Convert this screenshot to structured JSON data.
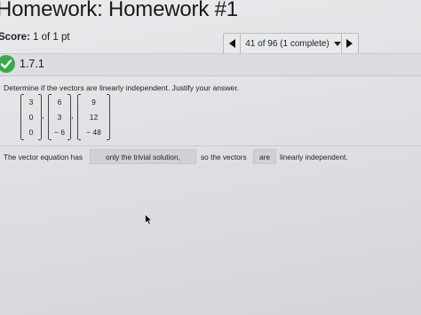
{
  "header": {
    "title": "Homework: Homework #1",
    "score_label": "Score:",
    "score_value": "1 of 1 pt"
  },
  "navigator": {
    "status": "41 of 96 (1 complete)",
    "prev_icon": "triangle-left-icon",
    "next_icon": "triangle-right-icon",
    "dropdown_icon": "triangle-down-icon"
  },
  "question": {
    "number": "1.7.1",
    "status_icon": "check-icon",
    "status_color": "#3aaa49",
    "prompt": "Determine if the vectors are linearly independent. Justify your answer.",
    "vectors": [
      [
        "3",
        "0",
        "0"
      ],
      [
        "6",
        "3",
        "− 6"
      ],
      [
        "9",
        "12",
        "− 48"
      ]
    ],
    "separator": ",",
    "sentence_start": "The vector equation has",
    "answer_1": "only the trivial solution,",
    "sentence_mid": "so the vectors",
    "answer_2": "are",
    "sentence_end": "linearly independent."
  },
  "pointer": "mouse-cursor-icon"
}
